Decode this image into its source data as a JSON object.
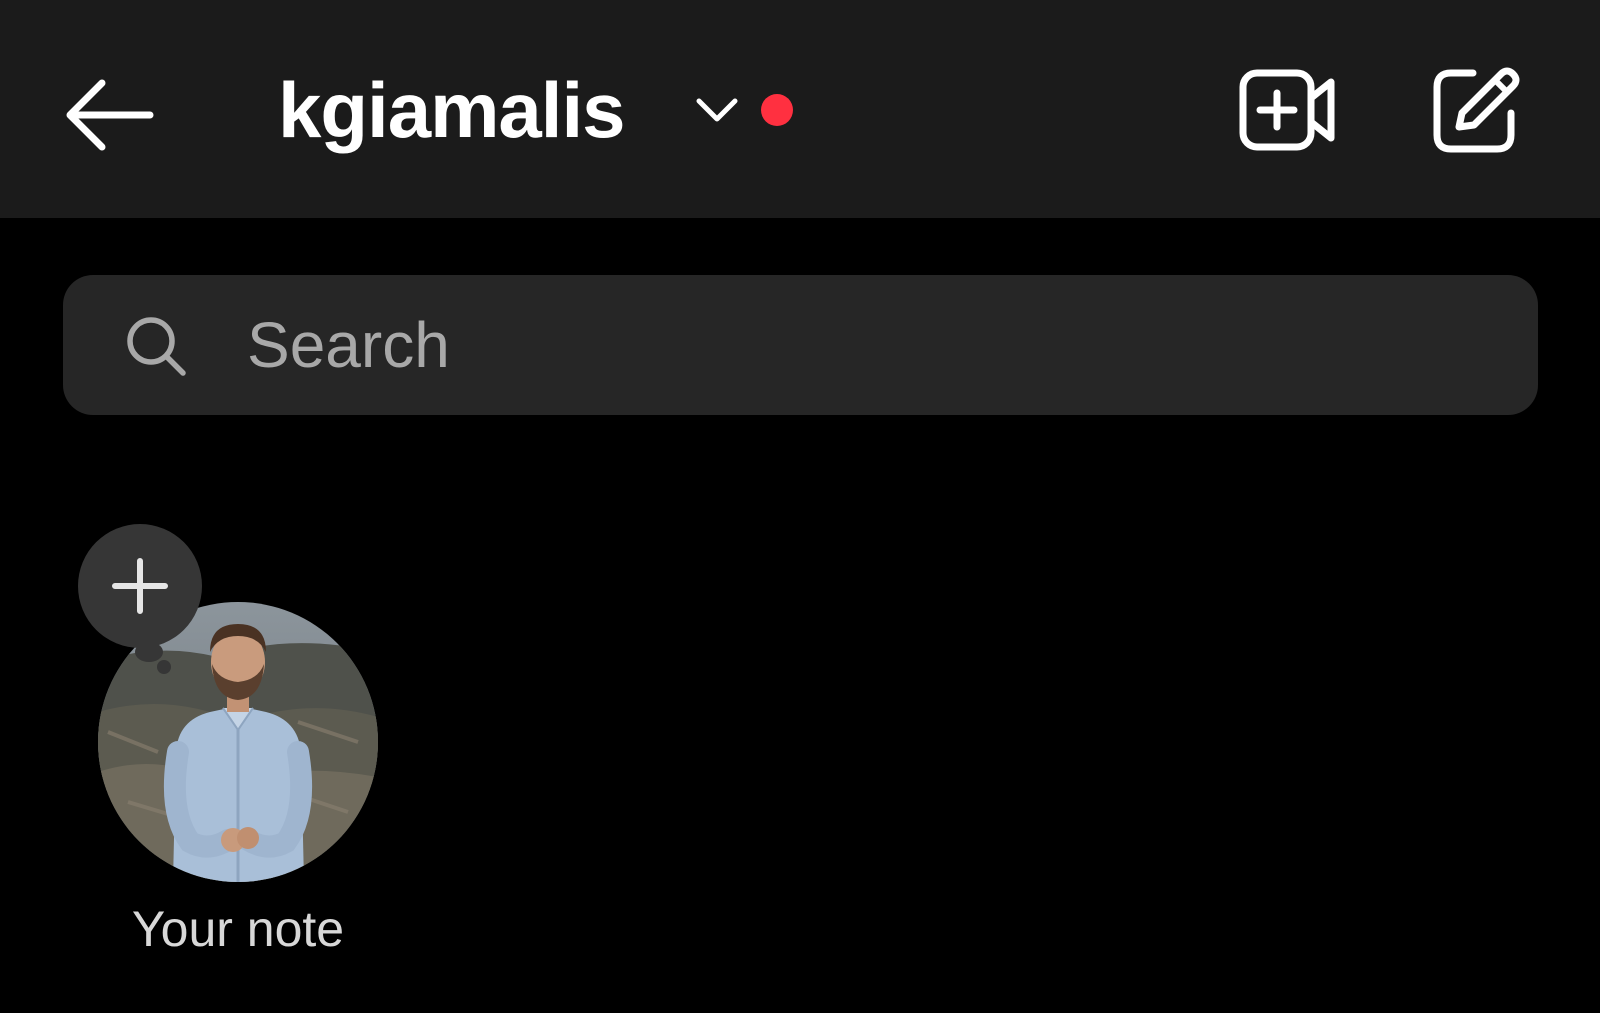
{
  "header": {
    "account_name": "kgiamalis",
    "has_live_indicator": true,
    "live_dot_color": "#ff3040",
    "icons": {
      "back": "arrow-left-icon",
      "switch_account": "chevron-down-icon",
      "new_video_call": "video-plus-icon",
      "compose": "compose-edit-icon"
    }
  },
  "search": {
    "placeholder": "Search",
    "value": "",
    "icon": "search-icon"
  },
  "notes": {
    "items": [
      {
        "label": "Your note",
        "add_icon": "plus-icon"
      }
    ]
  },
  "colors": {
    "background": "#000000",
    "header_background": "#1b1b1b",
    "search_background": "#262626",
    "note_bubble": "#363636"
  }
}
